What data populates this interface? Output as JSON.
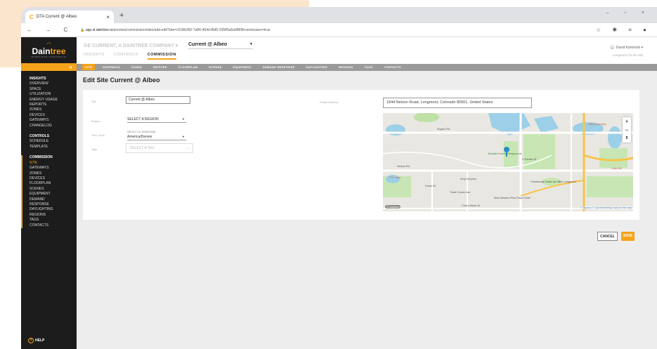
{
  "browser": {
    "tab_title": "DTA Current @ Albeo",
    "url_host": "app.st.daintree.io",
    "url_path": "/preview/commission/sites/add-edit?site=c518b350-7a86-494d-8bf5-20585a5a0f808commission=true"
  },
  "sidebar": {
    "logo_text_a": "Dain",
    "logo_text_b": "tree",
    "logo_sub": "WIRELESS CONTROLS",
    "sections": [
      {
        "header": "INSIGHTS",
        "items": [
          "OVERVIEW",
          "SPACE",
          "UTILIZATION",
          "ENERGY USAGE",
          "REPORTS",
          "ZONES",
          "DEVICES",
          "GATEWAYS",
          "CHANGELOG"
        ]
      },
      {
        "header": "CONTROLS",
        "items": [
          "SCHEDULE",
          "TEMPLATE"
        ]
      },
      {
        "header": "COMMISSION",
        "items": [
          "SITE",
          "GATEWAYS",
          "ZONES",
          "DEVICES",
          "FLOORPLAN",
          "SCENES",
          "EQUIPMENT",
          "DEMAND",
          "RESPONSE",
          "DAYLIGHTING",
          "REGIONS",
          "TAGS",
          "CONTACTS"
        ],
        "active": "SITE"
      }
    ],
    "help": "HELP"
  },
  "header": {
    "org": "GE CURRENT, A DAINTREE COMPANY",
    "site": "Current @ Albeo",
    "tabs": [
      "INSIGHTS",
      "CONTROLS",
      "COMMISSION"
    ],
    "active_tab": "COMMISSION",
    "user": "David Kaminski",
    "location": "Longmont (11:06 AM)"
  },
  "subnav": [
    "SITE",
    "GATEWAYS",
    "ZONES",
    "DEVICES",
    "FLOORPLAN",
    "SCENES",
    "EQUIPMENT",
    "DEMAND RESPONSE",
    "DAYLIGHTING",
    "REGIONS",
    "TAGS",
    "CONTACTS"
  ],
  "page": {
    "title": "Edit Site Current @ Albeo",
    "site_label": "Site",
    "site_value": "Current @ Albeo",
    "region_label": "Region",
    "region_value": "SELECT A REGION",
    "tz_label": "Time Zone",
    "tz_caption": "SELECT A TIMEZONE",
    "tz_value": "America/Denver",
    "tags_label": "Tags",
    "tags_placeholder": "SELECT A TAG",
    "address_label": "Postal Address",
    "address_value": "1844 Nelson Road, Longmont, Colorado 80501, United States"
  },
  "map": {
    "labels": [
      "Rogers Rd",
      "Nelson Rd",
      "Boulder County Fairgrounds",
      "King Soopers",
      "Trade Centre Ave",
      "Best Western Plus Plaza Hotel",
      "Homewood Suites by Hilton Longmont",
      "Clover Basin Dr",
      "Wibby Brewing",
      "Cafe Rio",
      "CTC Lake",
      "Hover St",
      "S Sunset St"
    ],
    "zoom_in": "+",
    "zoom_out": "−",
    "compass": "⬆",
    "attribution": "© Mapbox © OpenStreetMap Improve this map",
    "brand": "© mapbox"
  },
  "actions": {
    "cancel": "CANCEL",
    "save": "SAVE"
  },
  "colors": {
    "accent": "#f5a31a",
    "sidebar": "#1c1c1c"
  }
}
